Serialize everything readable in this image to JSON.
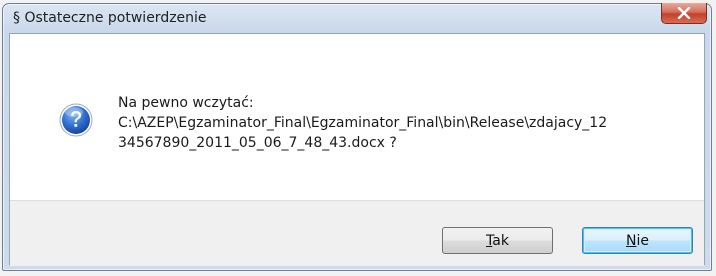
{
  "dialog": {
    "title": "§ Ostateczne potwierdzenie",
    "message_line1": "Na pewno wczytać:",
    "message_line2": "C:\\AZEP\\Egzaminator_Final\\Egzaminator_Final\\bin\\Release\\zdajacy_12",
    "message_line3": "34567890_2011_05_06_7_48_43.docx ?",
    "icon": "question-icon"
  },
  "buttons": {
    "yes_mnemonic": "T",
    "yes_rest": "ak",
    "no_mnemonic": "N",
    "no_rest": "ie"
  },
  "colors": {
    "close_button": "#c7432b",
    "default_button_border": "#3c7fb1",
    "icon_blue": "#1c5fbd"
  }
}
